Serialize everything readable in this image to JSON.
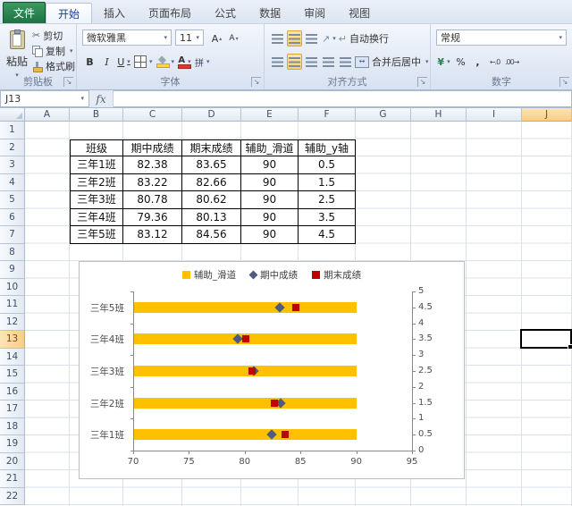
{
  "window": {
    "file_tab": "文件",
    "tabs": [
      "开始",
      "插入",
      "页面布局",
      "公式",
      "数据",
      "审阅",
      "视图"
    ],
    "active_tab": "开始"
  },
  "ribbon": {
    "clipboard": {
      "paste": "粘贴",
      "cut": "剪切",
      "copy": "复制",
      "format_painter": "格式刷",
      "group_label": "剪贴板"
    },
    "font": {
      "font_name": "微软雅黑",
      "font_size": "11",
      "bold": "B",
      "italic": "I",
      "underline": "U",
      "grow_font": "A",
      "shrink_font": "A",
      "font_color_letter": "A",
      "group_label": "字体"
    },
    "alignment": {
      "wrap_text": "自动换行",
      "merge_center": "合并后居中",
      "group_label": "对齐方式"
    },
    "number": {
      "format": "常规",
      "currency": "¥",
      "percent": "%",
      "comma": ",",
      "group_label": "数字"
    }
  },
  "formula_bar": {
    "name_box": "J13",
    "fx": "fx",
    "formula": ""
  },
  "sheet": {
    "columns": [
      "A",
      "B",
      "C",
      "D",
      "E",
      "F",
      "G",
      "H",
      "I",
      "J"
    ],
    "rows": [
      "1",
      "2",
      "3",
      "4",
      "5",
      "6",
      "7",
      "8",
      "9",
      "10",
      "11",
      "12",
      "13",
      "14",
      "15",
      "16",
      "17",
      "18",
      "19",
      "20",
      "21",
      "22"
    ],
    "selected_cell": "J13"
  },
  "table": {
    "origin": "B2",
    "headers": [
      "班级",
      "期中成绩",
      "期末成绩",
      "辅助_滑道",
      "辅助_y轴"
    ],
    "rows": [
      [
        "三年1班",
        "82.38",
        "83.65",
        "90",
        "0.5"
      ],
      [
        "三年2班",
        "83.22",
        "82.66",
        "90",
        "1.5"
      ],
      [
        "三年3班",
        "80.78",
        "80.62",
        "90",
        "2.5"
      ],
      [
        "三年4班",
        "79.36",
        "80.13",
        "90",
        "3.5"
      ],
      [
        "三年5班",
        "83.12",
        "84.56",
        "90",
        "4.5"
      ]
    ]
  },
  "chart_data": {
    "type": "bar",
    "variant": "horizontal-bar-with-scatter-markers",
    "title": "",
    "xlabel": "",
    "ylabel": "",
    "categories": [
      "三年1班",
      "三年2班",
      "三年3班",
      "三年4班",
      "三年5班"
    ],
    "series": [
      {
        "name": "辅助_滑道",
        "type": "bar",
        "color": "#FFC000",
        "values": [
          90,
          90,
          90,
          90,
          90
        ]
      },
      {
        "name": "期中成绩",
        "type": "scatter",
        "marker": "diamond",
        "color": "#4D5B7C",
        "values": [
          82.38,
          83.22,
          80.78,
          79.36,
          83.12
        ]
      },
      {
        "name": "期末成绩",
        "type": "scatter",
        "marker": "square",
        "color": "#C00000",
        "values": [
          83.65,
          82.66,
          80.62,
          80.13,
          84.56
        ]
      }
    ],
    "x_axis": {
      "min": 70,
      "max": 95,
      "step": 5,
      "ticks": [
        "70",
        "75",
        "80",
        "85",
        "90",
        "95"
      ]
    },
    "y2_axis": {
      "min": 0,
      "max": 5,
      "step": 0.5,
      "ticks": [
        "0",
        "0.5",
        "1",
        "1.5",
        "2",
        "2.5",
        "3",
        "3.5",
        "4",
        "4.5",
        "5"
      ]
    },
    "legend_position": "top",
    "gridlines": false
  }
}
